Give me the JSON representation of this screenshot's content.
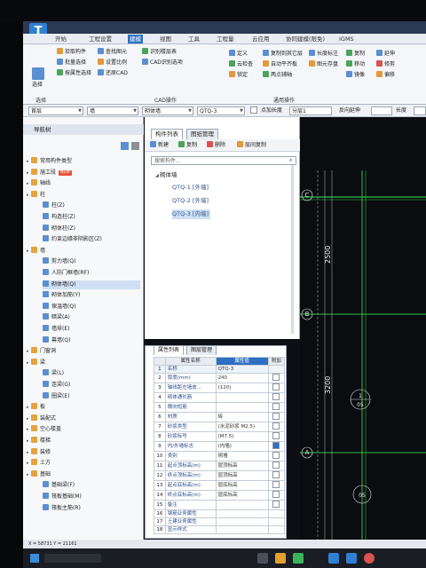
{
  "menu": [
    "开始",
    "工程设置",
    "建模",
    "视图",
    "工具",
    "工程量",
    "云应用",
    "协同建模(限免)",
    "IGMS"
  ],
  "menu_active_index": 2,
  "ribbon": {
    "select_label": "选择",
    "select_group": "选择",
    "cad_group": "CAD操作",
    "common_group": "通用操作",
    "items": [
      "拾取构件",
      "批量选择",
      "按属性选择",
      "查找图元",
      "设置比例",
      "还原CAD",
      "识别楼层表",
      "CAD识别选项",
      "定义",
      "云检查",
      "锁定",
      "复制到其它层",
      "自动平齐板",
      "两点辅轴",
      "长度标注",
      "图元存盘",
      "复制",
      "延伸",
      "移动",
      "修剪",
      "镜像",
      "偏移"
    ]
  },
  "filter": {
    "floor": "首层",
    "type": "墙",
    "subtype": "砌体墙",
    "component": "QTQ-3",
    "layer": "分层1",
    "option1": "点加长度",
    "option2": "反向延伸",
    "option3": "长度"
  },
  "nav": {
    "title": "导航树",
    "items": [
      {
        "label": "常用构件类型",
        "level": 0,
        "icon": "folder"
      },
      {
        "label": "施工段",
        "level": 0,
        "icon": "folder",
        "badge": "NEW"
      },
      {
        "label": "轴线",
        "level": 0,
        "icon": "folder"
      },
      {
        "label": "柱",
        "level": 0,
        "icon": "folder"
      },
      {
        "label": "柱(Z)",
        "level": 1,
        "icon": "comp"
      },
      {
        "label": "构造柱(Z)",
        "level": 1,
        "icon": "comp"
      },
      {
        "label": "砌体柱(Z)",
        "level": 1,
        "icon": "comp"
      },
      {
        "label": "约束边缘非阴影区(Z)",
        "level": 1,
        "icon": "comp"
      },
      {
        "label": "墙",
        "level": 0,
        "icon": "folder"
      },
      {
        "label": "剪力墙(Q)",
        "level": 1,
        "icon": "comp"
      },
      {
        "label": "人防门框墙(RF)",
        "level": 1,
        "icon": "comp"
      },
      {
        "label": "砌体墙(Q)",
        "level": 1,
        "icon": "comp",
        "selected": true
      },
      {
        "label": "砌体加筋(Y)",
        "level": 1,
        "icon": "comp"
      },
      {
        "label": "保温墙(Q)",
        "level": 1,
        "icon": "comp"
      },
      {
        "label": "暗梁(A)",
        "level": 1,
        "icon": "comp"
      },
      {
        "label": "墙垛(E)",
        "level": 1,
        "icon": "comp"
      },
      {
        "label": "幕墙(Q)",
        "level": 1,
        "icon": "comp"
      },
      {
        "label": "门窗洞",
        "level": 0,
        "icon": "folder"
      },
      {
        "label": "梁",
        "level": 0,
        "icon": "folder"
      },
      {
        "label": "梁(L)",
        "level": 1,
        "icon": "comp"
      },
      {
        "label": "连梁(G)",
        "level": 1,
        "icon": "comp"
      },
      {
        "label": "圈梁(E)",
        "level": 1,
        "icon": "comp"
      },
      {
        "label": "板",
        "level": 0,
        "icon": "folder"
      },
      {
        "label": "装配式",
        "level": 0,
        "icon": "folder"
      },
      {
        "label": "空心楼盖",
        "level": 0,
        "icon": "folder"
      },
      {
        "label": "楼梯",
        "level": 0,
        "icon": "folder"
      },
      {
        "label": "装修",
        "level": 0,
        "icon": "folder"
      },
      {
        "label": "土方",
        "level": 0,
        "icon": "folder"
      },
      {
        "label": "基础",
        "level": 0,
        "icon": "folder"
      },
      {
        "label": "基础梁(F)",
        "level": 1,
        "icon": "comp"
      },
      {
        "label": "筏板基础(M)",
        "level": 1,
        "icon": "comp"
      },
      {
        "label": "筏板主筋(R)",
        "level": 1,
        "icon": "comp"
      }
    ]
  },
  "component_panel": {
    "tab_list": "构件列表",
    "tab_drawing": "图纸管理",
    "new_label": "新建",
    "copy_label": "复制",
    "delete_label": "删除",
    "layer_copy_label": "层间复制",
    "search_placeholder": "搜索构件...",
    "group_label": "砌体墙",
    "items": [
      "QTQ-1 [外墙]",
      "QTQ-2 [外墙]",
      "QTQ-3 [内墙]"
    ],
    "selected_index": 2
  },
  "property_panel": {
    "tab_props": "属性列表",
    "tab_layers": "图层管理",
    "col_name": "属性名称",
    "col_value": "属性值",
    "col_add": "附加",
    "rows": [
      {
        "n": "1",
        "name": "名称",
        "value": "QTQ-3",
        "chk": null
      },
      {
        "n": "2",
        "name": "厚度(mm)",
        "value": "240",
        "chk": false
      },
      {
        "n": "3",
        "name": "轴线距左墙皮...",
        "value": "(120)",
        "chk": false
      },
      {
        "n": "4",
        "name": "砌体通长筋",
        "value": "",
        "chk": false
      },
      {
        "n": "5",
        "name": "横向短筋",
        "value": "",
        "chk": false
      },
      {
        "n": "6",
        "name": "材质",
        "value": "砖",
        "chk": false
      },
      {
        "n": "7",
        "name": "砂浆类型",
        "value": "(水泥砂浆 M2.5)",
        "chk": false
      },
      {
        "n": "8",
        "name": "砂浆标号",
        "value": "(M7.5)",
        "chk": false
      },
      {
        "n": "9",
        "name": "内/外墙标志",
        "value": "(内墙)",
        "chk": true
      },
      {
        "n": "10",
        "name": "类别",
        "value": "砌墙",
        "chk": false
      },
      {
        "n": "11",
        "name": "起点顶标高(m)",
        "value": "层顶标高",
        "chk": false
      },
      {
        "n": "12",
        "name": "终点顶标高(m)",
        "value": "层顶标高",
        "chk": false
      },
      {
        "n": "13",
        "name": "起点底标高(m)",
        "value": "层底标高",
        "chk": false
      },
      {
        "n": "14",
        "name": "终点底标高(m)",
        "value": "层底标高",
        "chk": false
      },
      {
        "n": "15",
        "name": "备注",
        "value": "",
        "chk": false
      },
      {
        "n": "16",
        "name": "钢筋业务属性",
        "value": "",
        "chk": null
      },
      {
        "n": "17",
        "name": "土建业务属性",
        "value": "",
        "chk": null
      },
      {
        "n": "18",
        "name": "显示样式",
        "value": "",
        "chk": null
      }
    ]
  },
  "canvas": {
    "axis_labels": [
      "C",
      "B",
      "A"
    ],
    "dims": [
      "2500",
      "3200"
    ],
    "circle_labels": [
      "1",
      "05"
    ]
  },
  "statusbar": {
    "coords": "X = 58731 Y = 21161"
  },
  "colors": {
    "accent": "#2e6fc4",
    "canvas_bg": "#0a0c10",
    "cad_line": "#2fbf4a",
    "cad_text": "#e8e8e8"
  }
}
